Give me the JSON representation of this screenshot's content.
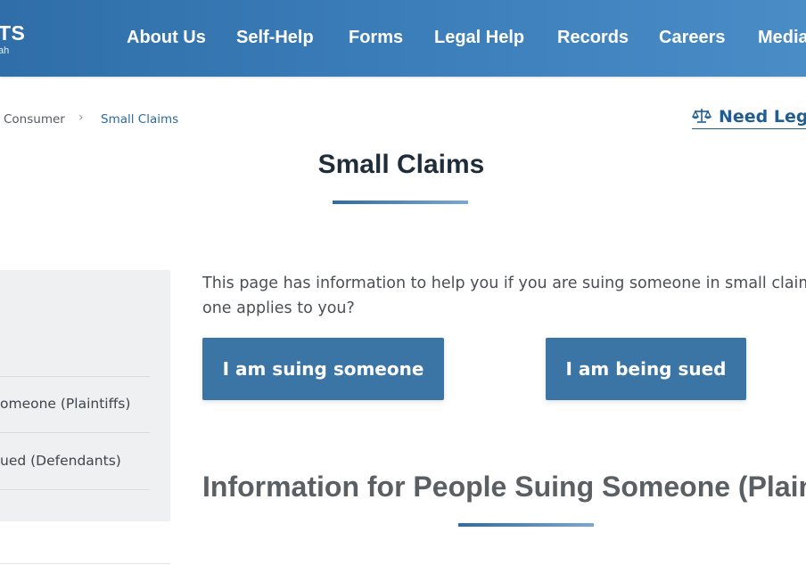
{
  "header": {
    "logo_text": "TS",
    "logo_subtext": "ah",
    "nav": [
      {
        "label": "About Us"
      },
      {
        "label": "Self-Help"
      },
      {
        "label": "Forms"
      },
      {
        "label": "Legal Help"
      },
      {
        "label": "Records"
      },
      {
        "label": "Careers"
      },
      {
        "label": "Media"
      }
    ]
  },
  "breadcrumb": {
    "parent": "Consumer",
    "separator": "›",
    "current": "Small Claims"
  },
  "need_legal_link": "Need Legal",
  "page_title": "Small Claims",
  "sidebar": {
    "items": [
      {
        "label": "omeone (Plaintiffs)"
      },
      {
        "label": "ued (Defendants)"
      }
    ]
  },
  "main": {
    "intro": "This page has information to help you if you are suing someone in small claims c one applies to you?",
    "buttons": {
      "suing": "I am suing someone",
      "sued": "I am being sued"
    },
    "section_heading": "Information for People Suing Someone (Plainti"
  },
  "colors": {
    "header_bg": "#3a7cb8",
    "button_bg": "#3a75a6",
    "link": "#1f5d94",
    "title": "#1f2d3a",
    "sidebar_bg": "#eef0f2"
  },
  "icons": {
    "need_legal": "balance-scale-icon",
    "breadcrumb_separator": "chevron-right-icon"
  }
}
